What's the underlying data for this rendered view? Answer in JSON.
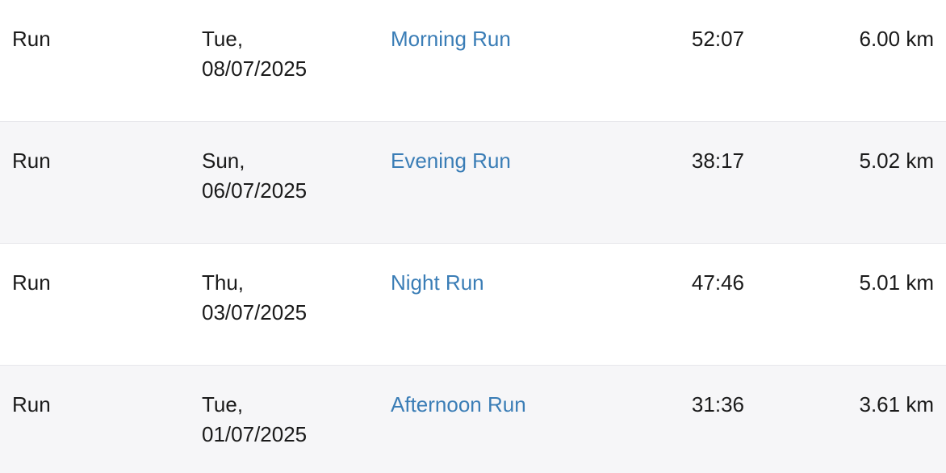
{
  "activities": [
    {
      "sport": "Run",
      "day": "Tue,",
      "date": "08/07/2025",
      "title": "Morning Run",
      "time": "52:07",
      "distance": "6.00 km"
    },
    {
      "sport": "Run",
      "day": "Sun,",
      "date": "06/07/2025",
      "title": "Evening Run",
      "time": "38:17",
      "distance": "5.02 km"
    },
    {
      "sport": "Run",
      "day": "Thu,",
      "date": "03/07/2025",
      "title": "Night Run",
      "time": "47:46",
      "distance": "5.01 km"
    },
    {
      "sport": "Run",
      "day": "Tue,",
      "date": "01/07/2025",
      "title": "Afternoon Run",
      "time": "31:36",
      "distance": "3.61 km"
    }
  ],
  "colors": {
    "link": "#3a7db6",
    "alt_row": "#f6f6f8",
    "divider": "#e8e8ec"
  }
}
